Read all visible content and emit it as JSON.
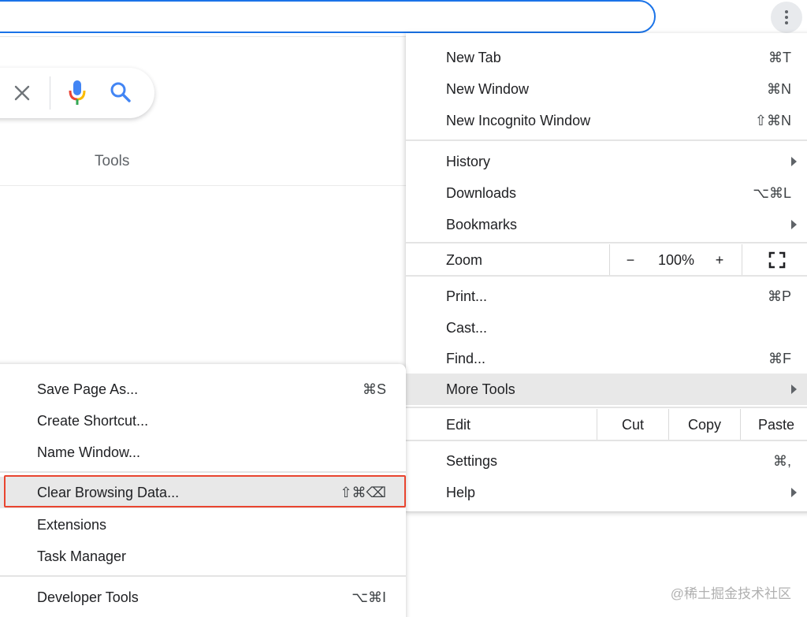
{
  "background_page": {
    "tools_label": "Tools",
    "watermark": "@稀土掘金技术社区"
  },
  "menu": {
    "group1": [
      {
        "label": "New Tab",
        "shortcut": "⌘T"
      },
      {
        "label": "New Window",
        "shortcut": "⌘N"
      },
      {
        "label": "New Incognito Window",
        "shortcut": "⇧⌘N"
      }
    ],
    "group2": [
      {
        "label": "History",
        "shortcut": ""
      },
      {
        "label": "Downloads",
        "shortcut": "⌥⌘L"
      },
      {
        "label": "Bookmarks",
        "shortcut": ""
      }
    ],
    "zoom": {
      "label": "Zoom",
      "minus": "−",
      "value": "100%",
      "plus": "+"
    },
    "group3": [
      {
        "label": "Print...",
        "shortcut": "⌘P"
      },
      {
        "label": "Cast...",
        "shortcut": ""
      },
      {
        "label": "Find...",
        "shortcut": "⌘F"
      },
      {
        "label": "More Tools",
        "shortcut": ""
      }
    ],
    "edit": {
      "label": "Edit",
      "cut": "Cut",
      "copy": "Copy",
      "paste": "Paste"
    },
    "group4": [
      {
        "label": "Settings",
        "shortcut": "⌘,"
      },
      {
        "label": "Help",
        "shortcut": ""
      }
    ]
  },
  "submenu": {
    "group1": [
      {
        "label": "Save Page As...",
        "shortcut": "⌘S"
      },
      {
        "label": "Create Shortcut...",
        "shortcut": ""
      },
      {
        "label": "Name Window...",
        "shortcut": ""
      }
    ],
    "group2": [
      {
        "label": "Clear Browsing Data...",
        "shortcut": "⇧⌘⌫"
      },
      {
        "label": "Extensions",
        "shortcut": ""
      },
      {
        "label": "Task Manager",
        "shortcut": ""
      }
    ],
    "group3": [
      {
        "label": "Developer Tools",
        "shortcut": "⌥⌘I"
      }
    ]
  },
  "colors": {
    "accent": "#1a73e8",
    "highlight": "#e8e8e8",
    "annotation": "#e9452f"
  }
}
